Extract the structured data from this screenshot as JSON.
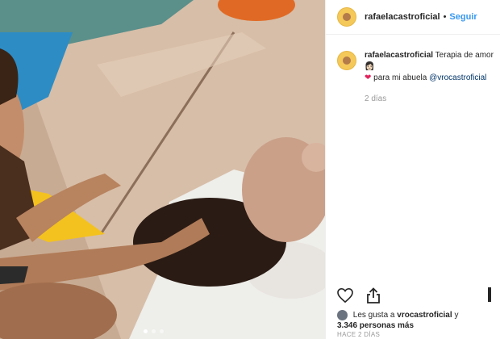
{
  "post": {
    "username": "rafaelacastroficial",
    "separator": "•",
    "follow_label": "Seguir"
  },
  "caption": {
    "username": "rafaelacastroficial",
    "text_part1": "Terapia de amor",
    "emoji_pray": "👩🏻",
    "emoji_heart": "❤",
    "text_part2": "para mi abuela",
    "mention": "@vrocastroficial",
    "time": "2 días"
  },
  "likes": {
    "prefix": "Les gusta a",
    "user": "vrocastroficial",
    "and": "y",
    "count": "3.346 personas más"
  },
  "post_time": "HACE 2 DÍAS",
  "icons": {
    "like": "heart-outline-icon",
    "share": "share-icon",
    "save": "bookmark-icon"
  },
  "carousel": {
    "count": 3,
    "active": 1
  }
}
